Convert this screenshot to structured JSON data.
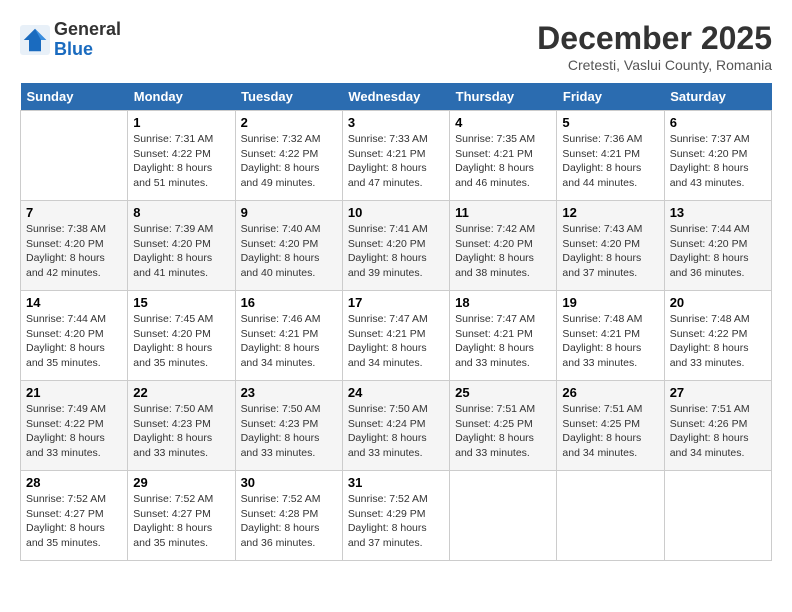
{
  "logo": {
    "general": "General",
    "blue": "Blue"
  },
  "title": "December 2025",
  "location": "Cretesti, Vaslui County, Romania",
  "days_of_week": [
    "Sunday",
    "Monday",
    "Tuesday",
    "Wednesday",
    "Thursday",
    "Friday",
    "Saturday"
  ],
  "weeks": [
    [
      {
        "day": "",
        "info": ""
      },
      {
        "day": "1",
        "info": "Sunrise: 7:31 AM\nSunset: 4:22 PM\nDaylight: 8 hours\nand 51 minutes."
      },
      {
        "day": "2",
        "info": "Sunrise: 7:32 AM\nSunset: 4:22 PM\nDaylight: 8 hours\nand 49 minutes."
      },
      {
        "day": "3",
        "info": "Sunrise: 7:33 AM\nSunset: 4:21 PM\nDaylight: 8 hours\nand 47 minutes."
      },
      {
        "day": "4",
        "info": "Sunrise: 7:35 AM\nSunset: 4:21 PM\nDaylight: 8 hours\nand 46 minutes."
      },
      {
        "day": "5",
        "info": "Sunrise: 7:36 AM\nSunset: 4:21 PM\nDaylight: 8 hours\nand 44 minutes."
      },
      {
        "day": "6",
        "info": "Sunrise: 7:37 AM\nSunset: 4:20 PM\nDaylight: 8 hours\nand 43 minutes."
      }
    ],
    [
      {
        "day": "7",
        "info": "Sunrise: 7:38 AM\nSunset: 4:20 PM\nDaylight: 8 hours\nand 42 minutes."
      },
      {
        "day": "8",
        "info": "Sunrise: 7:39 AM\nSunset: 4:20 PM\nDaylight: 8 hours\nand 41 minutes."
      },
      {
        "day": "9",
        "info": "Sunrise: 7:40 AM\nSunset: 4:20 PM\nDaylight: 8 hours\nand 40 minutes."
      },
      {
        "day": "10",
        "info": "Sunrise: 7:41 AM\nSunset: 4:20 PM\nDaylight: 8 hours\nand 39 minutes."
      },
      {
        "day": "11",
        "info": "Sunrise: 7:42 AM\nSunset: 4:20 PM\nDaylight: 8 hours\nand 38 minutes."
      },
      {
        "day": "12",
        "info": "Sunrise: 7:43 AM\nSunset: 4:20 PM\nDaylight: 8 hours\nand 37 minutes."
      },
      {
        "day": "13",
        "info": "Sunrise: 7:44 AM\nSunset: 4:20 PM\nDaylight: 8 hours\nand 36 minutes."
      }
    ],
    [
      {
        "day": "14",
        "info": "Sunrise: 7:44 AM\nSunset: 4:20 PM\nDaylight: 8 hours\nand 35 minutes."
      },
      {
        "day": "15",
        "info": "Sunrise: 7:45 AM\nSunset: 4:20 PM\nDaylight: 8 hours\nand 35 minutes."
      },
      {
        "day": "16",
        "info": "Sunrise: 7:46 AM\nSunset: 4:21 PM\nDaylight: 8 hours\nand 34 minutes."
      },
      {
        "day": "17",
        "info": "Sunrise: 7:47 AM\nSunset: 4:21 PM\nDaylight: 8 hours\nand 34 minutes."
      },
      {
        "day": "18",
        "info": "Sunrise: 7:47 AM\nSunset: 4:21 PM\nDaylight: 8 hours\nand 33 minutes."
      },
      {
        "day": "19",
        "info": "Sunrise: 7:48 AM\nSunset: 4:21 PM\nDaylight: 8 hours\nand 33 minutes."
      },
      {
        "day": "20",
        "info": "Sunrise: 7:48 AM\nSunset: 4:22 PM\nDaylight: 8 hours\nand 33 minutes."
      }
    ],
    [
      {
        "day": "21",
        "info": "Sunrise: 7:49 AM\nSunset: 4:22 PM\nDaylight: 8 hours\nand 33 minutes."
      },
      {
        "day": "22",
        "info": "Sunrise: 7:50 AM\nSunset: 4:23 PM\nDaylight: 8 hours\nand 33 minutes."
      },
      {
        "day": "23",
        "info": "Sunrise: 7:50 AM\nSunset: 4:23 PM\nDaylight: 8 hours\nand 33 minutes."
      },
      {
        "day": "24",
        "info": "Sunrise: 7:50 AM\nSunset: 4:24 PM\nDaylight: 8 hours\nand 33 minutes."
      },
      {
        "day": "25",
        "info": "Sunrise: 7:51 AM\nSunset: 4:25 PM\nDaylight: 8 hours\nand 33 minutes."
      },
      {
        "day": "26",
        "info": "Sunrise: 7:51 AM\nSunset: 4:25 PM\nDaylight: 8 hours\nand 34 minutes."
      },
      {
        "day": "27",
        "info": "Sunrise: 7:51 AM\nSunset: 4:26 PM\nDaylight: 8 hours\nand 34 minutes."
      }
    ],
    [
      {
        "day": "28",
        "info": "Sunrise: 7:52 AM\nSunset: 4:27 PM\nDaylight: 8 hours\nand 35 minutes."
      },
      {
        "day": "29",
        "info": "Sunrise: 7:52 AM\nSunset: 4:27 PM\nDaylight: 8 hours\nand 35 minutes."
      },
      {
        "day": "30",
        "info": "Sunrise: 7:52 AM\nSunset: 4:28 PM\nDaylight: 8 hours\nand 36 minutes."
      },
      {
        "day": "31",
        "info": "Sunrise: 7:52 AM\nSunset: 4:29 PM\nDaylight: 8 hours\nand 37 minutes."
      },
      {
        "day": "",
        "info": ""
      },
      {
        "day": "",
        "info": ""
      },
      {
        "day": "",
        "info": ""
      }
    ]
  ]
}
